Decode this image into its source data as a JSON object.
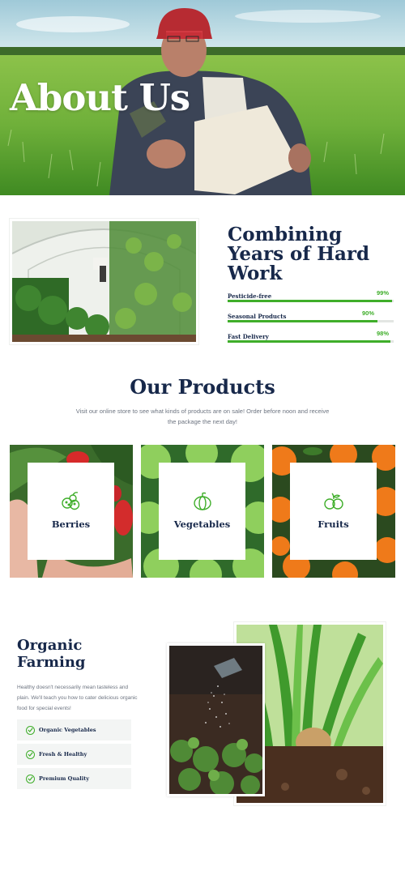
{
  "hero": {
    "title": "About Us"
  },
  "about": {
    "heading_lines": [
      "Combining",
      "Years of Hard",
      "Work"
    ],
    "skills": [
      {
        "label": "Pesticide-free",
        "percent_text": "99%",
        "value": 99
      },
      {
        "label": "Seasonal Products",
        "percent_text": "90%",
        "value": 90
      },
      {
        "label": "Fast Delivery",
        "percent_text": "98%",
        "value": 98
      }
    ]
  },
  "products": {
    "title": "Our Products",
    "description": "Visit our online store to see what kinds of products are on sale! Order before noon and receive the package the next day!",
    "items": [
      {
        "name": "Berries",
        "icon": "berries-icon"
      },
      {
        "name": "Vegetables",
        "icon": "pumpkin-icon"
      },
      {
        "name": "Fruits",
        "icon": "fruits-icon"
      }
    ]
  },
  "organic": {
    "title": "Organic Farming",
    "description": "Healthy doesn't necessarily mean tasteless and plain. We'll teach you how to cater delicious organic food for special events!",
    "features": [
      "Organic Vegetables",
      "Fresh & Healthy",
      "Premium Quality"
    ]
  },
  "colors": {
    "accent": "#3fae2a",
    "navy": "#17284a",
    "muted": "#6d7480"
  }
}
